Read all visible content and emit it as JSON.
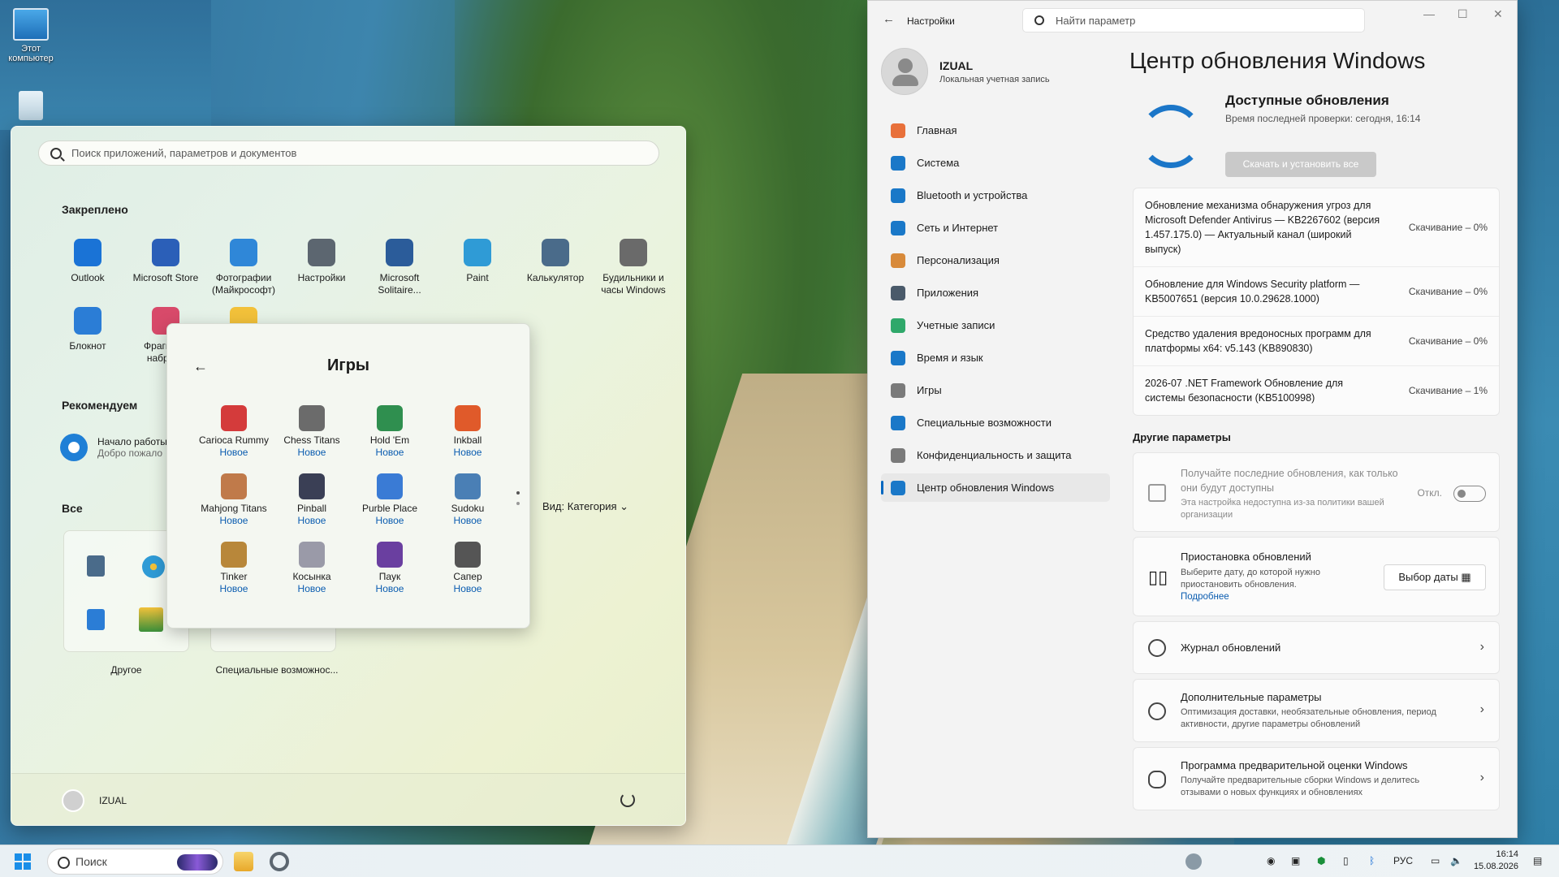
{
  "desktop": {
    "icons": [
      {
        "label": "Этот компьютер",
        "icon": "computer-icon"
      },
      {
        "label": "",
        "icon": "recycle-bin-icon"
      }
    ]
  },
  "start_menu": {
    "search_placeholder": "Поиск приложений, параметров и документов",
    "pinned_title": "Закреплено",
    "pinned": [
      {
        "label": "Outlook",
        "icon": "outlook-icon",
        "color": "#1a73d6"
      },
      {
        "label": "Microsoft Store",
        "icon": "store-icon",
        "color": "#2b5fb8"
      },
      {
        "label": "Фотографии (Майкрософт)",
        "icon": "photos-icon",
        "color": "#2f87d8"
      },
      {
        "label": "Настройки",
        "icon": "gear-icon",
        "color": "#5c6670"
      },
      {
        "label": "Microsoft Solitaire...",
        "icon": "solitaire-icon",
        "color": "#2b5c9a"
      },
      {
        "label": "Paint",
        "icon": "paint-icon",
        "color": "#2f9bd6"
      },
      {
        "label": "Калькулятор",
        "icon": "calculator-icon",
        "color": "#4a6b8a"
      },
      {
        "label": "Будильники и часы Windows",
        "icon": "clock-icon",
        "color": "#6a6a6a"
      },
      {
        "label": "Блокнот",
        "icon": "notepad-icon",
        "color": "#2b7dd6"
      },
      {
        "label": "Фрагмент набросо",
        "icon": "snipping-icon",
        "color": "#d84a6a"
      },
      {
        "label": "",
        "icon": "folder-icon",
        "color": "#f2c13a"
      }
    ],
    "recommended_title": "Рекомендуем",
    "recommended": {
      "title": "Начало работы",
      "subtitle": "Добро пожало"
    },
    "all_title": "Все",
    "view_label": "Вид: Категория",
    "categories": [
      {
        "label": "Другое"
      },
      {
        "label": "Специальные возможнос..."
      }
    ],
    "user_name": "IZUAL"
  },
  "games_folder": {
    "title": "Игры",
    "new_label": "Новое",
    "games": [
      {
        "label": "Carioca Rummy",
        "icon": "cards-icon",
        "color": "#d43b3b"
      },
      {
        "label": "Chess Titans",
        "icon": "chess-icon",
        "color": "#6b6b6b"
      },
      {
        "label": "Hold 'Em",
        "icon": "poker-icon",
        "color": "#2f8f4f"
      },
      {
        "label": "Inkball",
        "icon": "inkball-icon",
        "color": "#e05a2a"
      },
      {
        "label": "Mahjong Titans",
        "icon": "mahjong-icon",
        "color": "#c07a4a"
      },
      {
        "label": "Pinball",
        "icon": "pinball-icon",
        "color": "#3a3f55"
      },
      {
        "label": "Purble Place",
        "icon": "purble-icon",
        "color": "#3a7bd5"
      },
      {
        "label": "Sudoku",
        "icon": "sudoku-icon",
        "color": "#4a7fb5"
      },
      {
        "label": "Tinker",
        "icon": "tinker-icon",
        "color": "#b8873a"
      },
      {
        "label": "Косынка",
        "icon": "solitaire-card-icon",
        "color": "#9a9aa8"
      },
      {
        "label": "Паук",
        "icon": "spider-icon",
        "color": "#6a3fa0"
      },
      {
        "label": "Сапер",
        "icon": "mine-icon",
        "color": "#555555"
      }
    ]
  },
  "settings": {
    "app_title": "Настройки",
    "search_placeholder": "Найти параметр",
    "profile": {
      "name": "IZUAL",
      "type": "Локальная учетная запись"
    },
    "nav": [
      {
        "label": "Главная",
        "icon": "home-icon",
        "color": "#e8703a"
      },
      {
        "label": "Система",
        "icon": "system-icon",
        "color": "#1a78c8"
      },
      {
        "label": "Bluetooth и устройства",
        "icon": "bluetooth-icon",
        "color": "#1a78c8"
      },
      {
        "label": "Сеть и Интернет",
        "icon": "wifi-icon",
        "color": "#1a78c8"
      },
      {
        "label": "Персонализация",
        "icon": "brush-icon",
        "color": "#d88a3a"
      },
      {
        "label": "Приложения",
        "icon": "apps-icon",
        "color": "#4a5a6a"
      },
      {
        "label": "Учетные записи",
        "icon": "account-icon",
        "color": "#2fa86a"
      },
      {
        "label": "Время и язык",
        "icon": "globe-icon",
        "color": "#1a78c8"
      },
      {
        "label": "Игры",
        "icon": "gamepad-icon",
        "color": "#7a7a7a"
      },
      {
        "label": "Специальные возможности",
        "icon": "accessibility-icon",
        "color": "#1a78c8"
      },
      {
        "label": "Конфиденциальность и защита",
        "icon": "shield-icon",
        "color": "#7a7a7a"
      },
      {
        "label": "Центр обновления Windows",
        "icon": "update-icon",
        "color": "#1a78c8"
      }
    ],
    "page_title": "Центр обновления Windows",
    "updates_heading": "Доступные обновления",
    "last_check": "Время последней проверки: сегодня, 16:14",
    "install_button": "Скачать и установить все",
    "updates": [
      {
        "name": "Обновление механизма обнаружения угроз для Microsoft Defender Antivirus — KB2267602 (версия 1.457.175.0) — Актуальный канал (широкий выпуск)",
        "status": "Скачивание – 0%"
      },
      {
        "name": "Обновление для Windows Security platform — KB5007651 (версия 10.0.29628.1000)",
        "status": "Скачивание – 0%"
      },
      {
        "name": "Средство удаления вредоносных программ для платформы x64: v5.143 (KB890830)",
        "status": "Скачивание – 0%"
      },
      {
        "name": "2026-07 .NET Framework Обновление для системы безопасности (KB5100998)",
        "status": "Скачивание – 1%"
      }
    ],
    "other_title": "Другие параметры",
    "latest_updates": {
      "title": "Получайте последние обновления, как только они будут доступны",
      "desc": "Эта настройка недоступна из-за политики вашей организации",
      "toggle_label": "Откл."
    },
    "pause": {
      "title": "Приостановка обновлений",
      "desc": "Выберите дату, до которой нужно приостановить обновления.",
      "link": "Подробнее",
      "button": "Выбор даты"
    },
    "history": {
      "title": "Журнал обновлений"
    },
    "advanced": {
      "title": "Дополнительные параметры",
      "desc": "Оптимизация доставки, необязательные обновления, период активности, другие параметры обновлений"
    },
    "insider": {
      "title": "Программа предварительной оценки Windows",
      "desc": "Получайте предварительные сборки Windows и делитесь отзывами о новых функциях и обновлениях"
    }
  },
  "taskbar": {
    "search_label": "Поиск",
    "lang": "РУС",
    "time": "16:14",
    "date": "15.08.2026"
  }
}
